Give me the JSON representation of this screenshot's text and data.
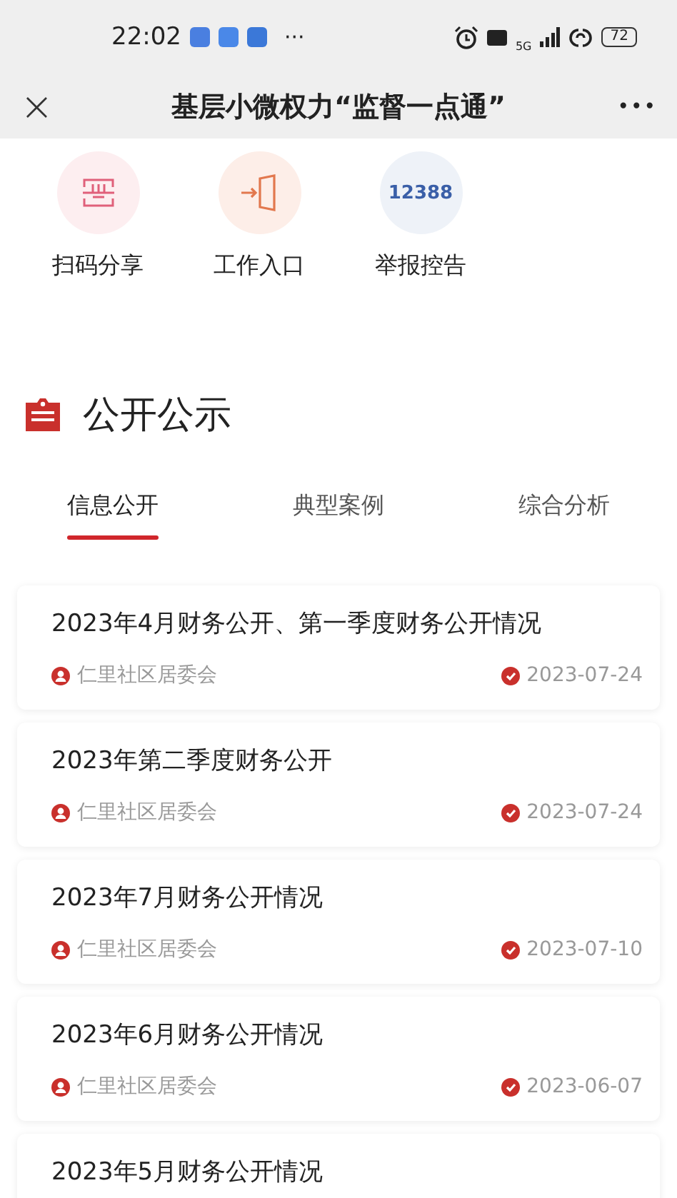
{
  "status_bar": {
    "time": "22:02",
    "more": "···",
    "network": "5G",
    "battery": "72"
  },
  "nav_bar": {
    "close": "×",
    "title": "基层小微权力“监督一点通”",
    "more": "•••"
  },
  "shortcuts": [
    {
      "kind": "scan",
      "label": "扫码分享"
    },
    {
      "kind": "entry",
      "label": "工作入口"
    },
    {
      "kind": "number",
      "number": "12388",
      "label": "举报控告"
    }
  ],
  "section": {
    "title": "公开公示"
  },
  "tabs": [
    {
      "label": "信息公开",
      "selected": true
    },
    {
      "label": "典型案例",
      "selected": false
    },
    {
      "label": "综合分析",
      "selected": false
    }
  ],
  "notices": [
    {
      "title": "2023年4月财务公开、第一季度财务公开情况",
      "publisher": "仁里社区居委会",
      "date": "2023-07-24"
    },
    {
      "title": "2023年第二季度财务公开",
      "publisher": "仁里社区居委会",
      "date": "2023-07-24"
    },
    {
      "title": "2023年7月财务公开情况",
      "publisher": "仁里社区居委会",
      "date": "2023-07-10"
    },
    {
      "title": "2023年6月财务公开情况",
      "publisher": "仁里社区居委会",
      "date": "2023-06-07"
    },
    {
      "title": "2023年5月财务公开情况"
    }
  ]
}
